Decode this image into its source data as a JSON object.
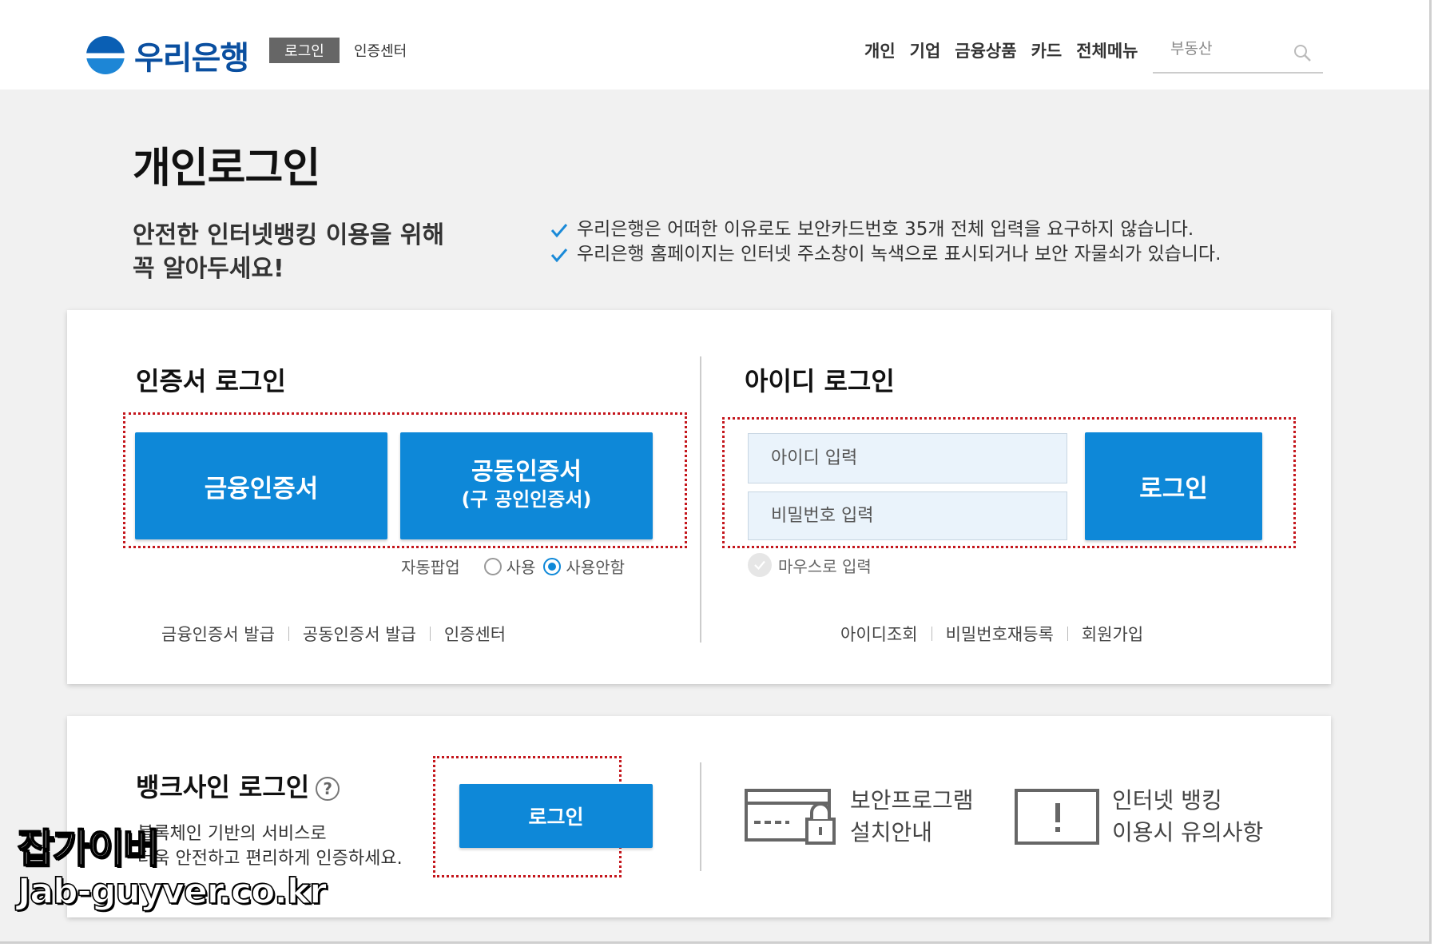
{
  "header": {
    "brand": "우리은행",
    "login_label": "로그인",
    "cert_center_label": "인증센터",
    "nav": [
      "개인",
      "기업",
      "금융상품",
      "카드",
      "전체메뉴"
    ],
    "search_placeholder": "부동산"
  },
  "page_title": "개인로그인",
  "notice": {
    "heading_line1": "안전한 인터넷뱅킹 이용을 위해",
    "heading_line2": "꼭 알아두세요!",
    "items": [
      "우리은행은 어떠한 이유로도 보안카드번호 35개 전체 입력을 요구하지 않습니다.",
      "우리은행 홈페이지는 인터넷 주소창이 녹색으로 표시되거나 보안 자물쇠가 있습니다."
    ]
  },
  "cert_login": {
    "title": "인증서 로그인",
    "btn_financial": "금융인증서",
    "btn_joint_line1": "공동인증서",
    "btn_joint_line2": "(구 공인인증서)",
    "popup_label": "자동팝업",
    "popup_use": "사용",
    "popup_nouse": "사용안함",
    "popup_selected": "사용안함",
    "links": [
      "금융인증서 발급",
      "공동인증서 발급",
      "인증센터"
    ]
  },
  "id_login": {
    "title": "아이디 로그인",
    "id_placeholder": "아이디 입력",
    "pw_placeholder": "비밀번호 입력",
    "login_btn": "로그인",
    "mouse_input": "마우스로 입력",
    "links": [
      "아이디조회",
      "비밀번호재등록",
      "회원가입"
    ]
  },
  "banksign": {
    "title": "뱅크사인 로그인",
    "help": "?",
    "desc_line1": "블록체인 기반의 서비스로",
    "desc_line2": "더욱 안전하고 편리하게 인증하세요.",
    "login_btn": "로그인"
  },
  "info": {
    "security_line1": "보안프로그램",
    "security_line2": "설치안내",
    "caution_line1": "인터넷 뱅킹",
    "caution_line2": "이용시 유의사항"
  },
  "watermark": {
    "line1": "잡가이버",
    "line2": "Jab-guyver.co.kr"
  },
  "colors": {
    "primary": "#0e88d8",
    "brand": "#0a4fa0",
    "highlight_border": "#c4161c",
    "background": "#f1f1f1"
  }
}
